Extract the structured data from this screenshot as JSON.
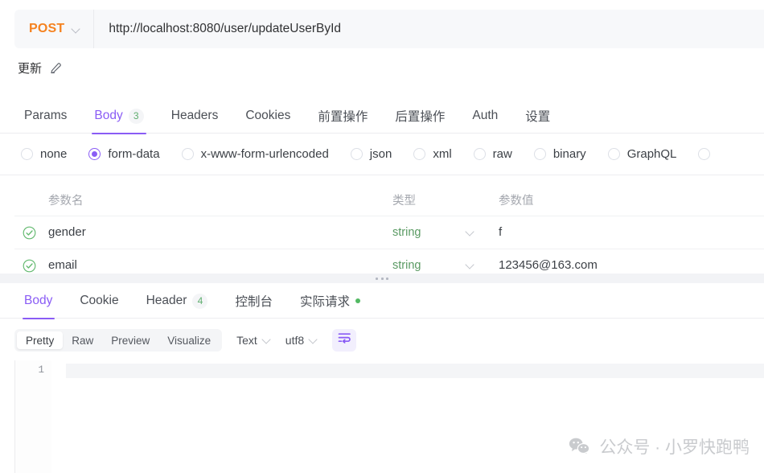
{
  "request": {
    "method": "POST",
    "url": "http://localhost:8080/user/updateUserById",
    "name": "更新"
  },
  "top_tabs": [
    {
      "label": "Params",
      "badge": "",
      "active": false
    },
    {
      "label": "Body",
      "badge": "3",
      "active": true
    },
    {
      "label": "Headers",
      "badge": "",
      "active": false
    },
    {
      "label": "Cookies",
      "badge": "",
      "active": false
    },
    {
      "label": "前置操作",
      "badge": "",
      "active": false
    },
    {
      "label": "后置操作",
      "badge": "",
      "active": false
    },
    {
      "label": "Auth",
      "badge": "",
      "active": false
    },
    {
      "label": "设置",
      "badge": "",
      "active": false
    }
  ],
  "body_types": [
    {
      "label": "none",
      "selected": false
    },
    {
      "label": "form-data",
      "selected": true
    },
    {
      "label": "x-www-form-urlencoded",
      "selected": false
    },
    {
      "label": "json",
      "selected": false
    },
    {
      "label": "xml",
      "selected": false
    },
    {
      "label": "raw",
      "selected": false
    },
    {
      "label": "binary",
      "selected": false
    },
    {
      "label": "GraphQL",
      "selected": false
    }
  ],
  "param_table": {
    "headers": {
      "name": "参数名",
      "type": "类型",
      "value": "参数值"
    },
    "rows": [
      {
        "enabled": true,
        "name": "gender",
        "type": "string",
        "value": "f"
      },
      {
        "enabled": true,
        "name": "email",
        "type": "string",
        "value": "123456@163.com"
      }
    ]
  },
  "bottom_tabs": [
    {
      "label": "Body",
      "badge": "",
      "dot": false,
      "active": true
    },
    {
      "label": "Cookie",
      "badge": "",
      "dot": false,
      "active": false
    },
    {
      "label": "Header",
      "badge": "4",
      "dot": false,
      "active": false
    },
    {
      "label": "控制台",
      "badge": "",
      "dot": false,
      "active": false
    },
    {
      "label": "实际请求",
      "badge": "",
      "dot": true,
      "active": false
    }
  ],
  "response_toolbar": {
    "views": [
      {
        "label": "Pretty",
        "active": true
      },
      {
        "label": "Raw",
        "active": false
      },
      {
        "label": "Preview",
        "active": false
      },
      {
        "label": "Visualize",
        "active": false
      }
    ],
    "format": "Text",
    "encoding": "utf8",
    "wrap_icon": "word-wrap-icon"
  },
  "editor": {
    "line_number": "1",
    "content": ""
  },
  "watermark": {
    "text": "公众号 · 小罗快跑鸭",
    "icon": "wechat-icon"
  },
  "colors": {
    "accent": "#8a5cf5",
    "method": "#f5821f",
    "success": "#5fae6e",
    "type_text": "#5a9a63"
  }
}
